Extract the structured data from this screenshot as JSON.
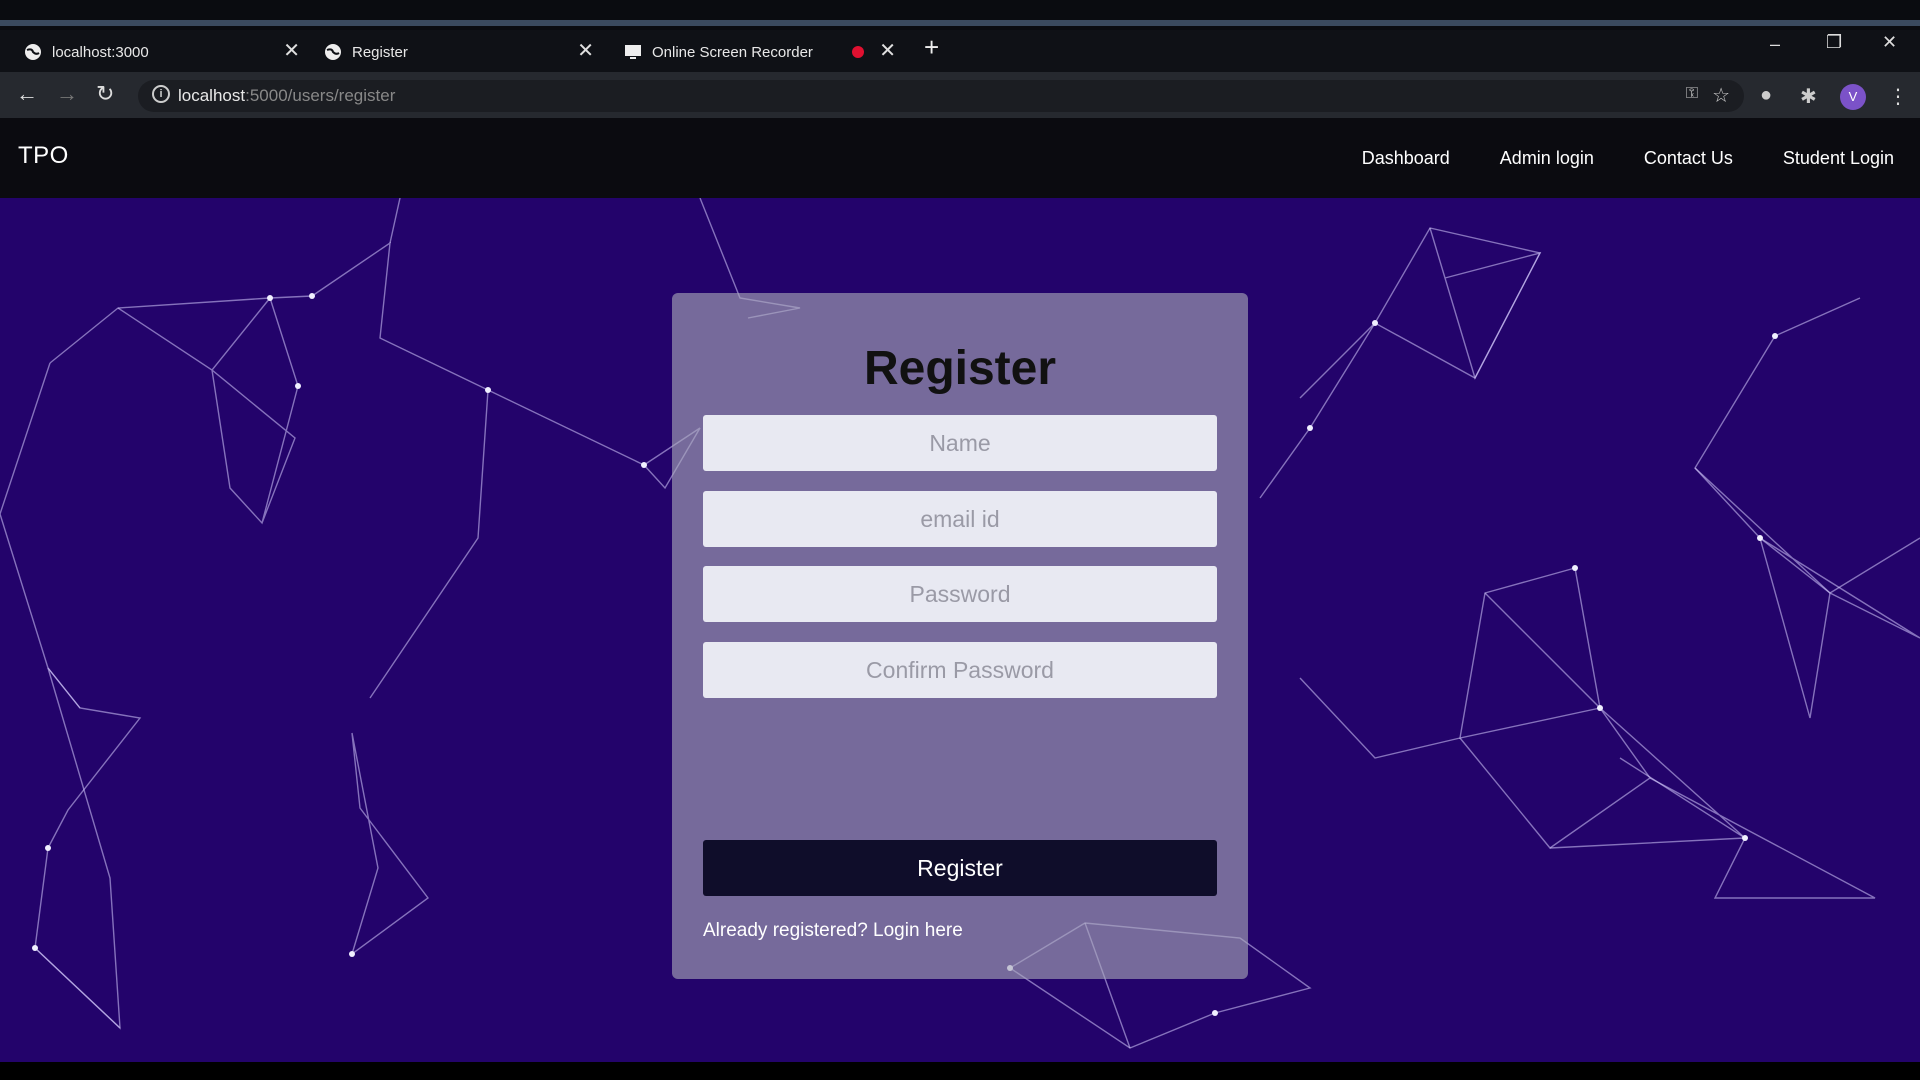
{
  "browser": {
    "tabs": [
      {
        "title": "localhost:3000",
        "icon": "globe-icon"
      },
      {
        "title": "Register",
        "icon": "globe-icon"
      },
      {
        "title": "Online Screen Recorder",
        "icon": "monitor-icon",
        "recording": true
      }
    ],
    "url_host": "localhost",
    "url_path": ":5000/users/register",
    "profile_initial": "V"
  },
  "navbar": {
    "brand": "TPO",
    "links": [
      "Dashboard",
      "Admin login",
      "Contact Us",
      "Student Login"
    ]
  },
  "form": {
    "title": "Register",
    "fields": {
      "name_placeholder": "Name",
      "email_placeholder": "email id",
      "password_placeholder": "Password",
      "confirm_placeholder": "Confirm Password"
    },
    "submit_label": "Register",
    "login_link": "Already registered? Login here"
  },
  "colors": {
    "background": "#23036b",
    "navbar": "#0b0b10",
    "button": "#0f0d2a",
    "card": "#aaaab9"
  }
}
